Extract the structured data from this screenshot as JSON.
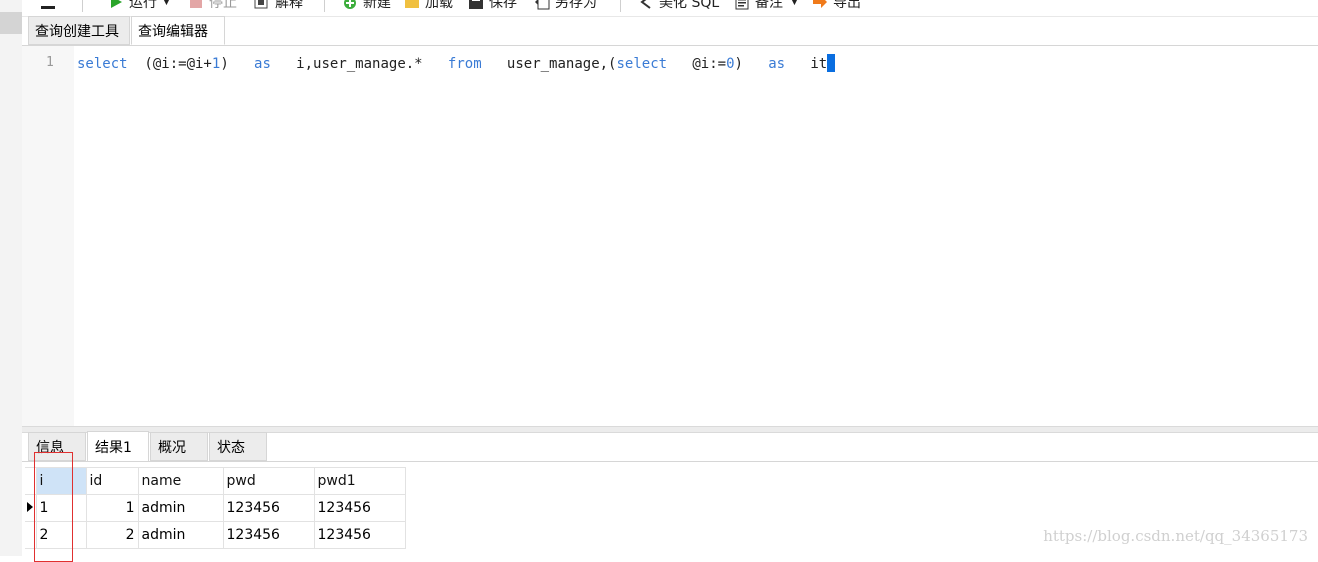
{
  "toolbar": {
    "run": "运行",
    "stop": "停止",
    "explain": "解释",
    "new": "新建",
    "load": "加载",
    "save": "保存",
    "save_as": "另存为",
    "beautify_sql": "美化 SQL",
    "snippet": "备注",
    "export": "导出"
  },
  "editor_tabs": [
    "查询创建工具",
    "查询编辑器"
  ],
  "editor": {
    "line_number": "1",
    "tokens": [
      {
        "t": "select",
        "k": "kw"
      },
      {
        "t": "  (@i:=@i+",
        "k": ""
      },
      {
        "t": "1",
        "k": "num"
      },
      {
        "t": ")   ",
        "k": ""
      },
      {
        "t": "as",
        "k": "kw"
      },
      {
        "t": "   i,user_manage.*   ",
        "k": ""
      },
      {
        "t": "from",
        "k": "kw"
      },
      {
        "t": "   user_manage,(",
        "k": ""
      },
      {
        "t": "select",
        "k": "kw"
      },
      {
        "t": "   @i:=",
        "k": ""
      },
      {
        "t": "0",
        "k": "num"
      },
      {
        "t": ")   ",
        "k": ""
      },
      {
        "t": "as",
        "k": "kw"
      },
      {
        "t": "   it",
        "k": ""
      }
    ]
  },
  "result_tabs": [
    "信息",
    "结果1",
    "概况",
    "状态"
  ],
  "grid": {
    "columns": [
      "i",
      "id",
      "name",
      "pwd",
      "pwd1"
    ],
    "rows": [
      [
        "1",
        "1",
        "admin",
        "123456",
        "123456"
      ],
      [
        "2",
        "2",
        "admin",
        "123456",
        "123456"
      ]
    ]
  },
  "watermark": "https://blog.csdn.net/qq_34365173",
  "colors": {
    "keyword": "#3a7bd5",
    "annotation": "#e03030",
    "caret": "#0a6ee0"
  }
}
